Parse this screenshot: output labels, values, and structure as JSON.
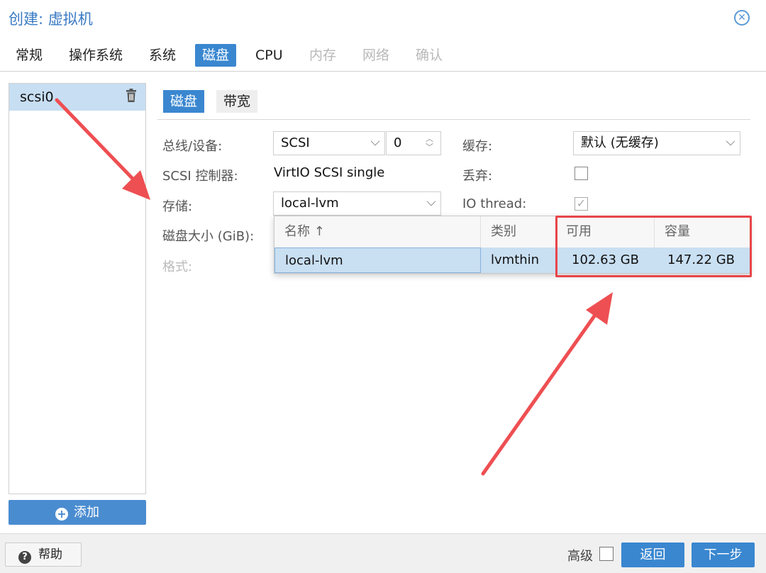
{
  "window": {
    "title": "创建: 虚拟机"
  },
  "tabs": [
    {
      "label": "常规",
      "state": "normal"
    },
    {
      "label": "操作系统",
      "state": "normal"
    },
    {
      "label": "系统",
      "state": "normal"
    },
    {
      "label": "磁盘",
      "state": "active"
    },
    {
      "label": "CPU",
      "state": "normal"
    },
    {
      "label": "内存",
      "state": "disabled"
    },
    {
      "label": "网络",
      "state": "disabled"
    },
    {
      "label": "确认",
      "state": "disabled"
    }
  ],
  "disk_list": {
    "items": [
      {
        "label": "scsi0"
      }
    ],
    "add_label": "添加"
  },
  "subtabs": [
    {
      "label": "磁盘"
    },
    {
      "label": "带宽"
    }
  ],
  "form": {
    "bus_label": "总线/设备:",
    "bus_value": "SCSI",
    "device_value": "0",
    "controller_label": "SCSI 控制器:",
    "controller_value": "VirtIO SCSI single",
    "storage_label": "存储:",
    "storage_value": "local-lvm",
    "size_label": "磁盘大小 (GiB):",
    "format_label": "格式:",
    "cache_label": "缓存:",
    "cache_value": "默认 (无缓存)",
    "discard_label": "丢弃:",
    "discard_checked": false,
    "iothread_label": "IO thread:",
    "iothread_checked": true
  },
  "storage_dropdown": {
    "columns": [
      "名称 ↑",
      "类别",
      "可用",
      "容量"
    ],
    "rows": [
      {
        "name": "local-lvm",
        "type": "lvmthin",
        "avail": "102.63 GB",
        "capacity": "147.22 GB"
      }
    ]
  },
  "footer": {
    "help_label": "帮助",
    "advanced_label": "高级",
    "back_label": "返回",
    "next_label": "下一步"
  },
  "colors": {
    "accent": "#3a87d0",
    "annotation": "#e8454a",
    "selection": "#c9dff2"
  }
}
